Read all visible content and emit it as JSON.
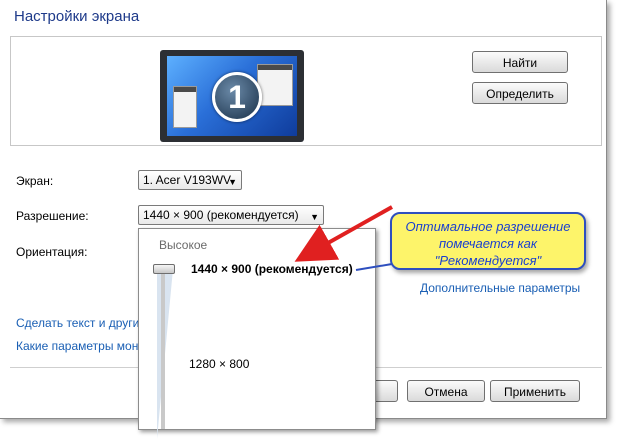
{
  "window": {
    "title": "Настройки экрана"
  },
  "buttons": {
    "find": "Найти",
    "identify": "Определить",
    "cancel": "Отмена",
    "apply": "Применить"
  },
  "monitor": {
    "number": "1"
  },
  "form": {
    "display_label": "Экран:",
    "display_value": "1. Acer V193WV",
    "resolution_label": "Разрешение:",
    "resolution_value": "1440 × 900 (рекомендуется)",
    "orientation_label": "Ориентация:"
  },
  "links": {
    "advanced": "Дополнительные параметры",
    "text_size": "Сделать текст и другие",
    "which_settings": "Какие параметры мон"
  },
  "resolution_popup": {
    "high_label": "Высокое",
    "top_option": "1440 × 900 (рекомендуется)",
    "lower_option": "1280 × 800",
    "slider_level": "1440 × 900"
  },
  "callout": {
    "lines": [
      "Оптимальное разрешение",
      "помечается как",
      "\"Рекомендуется\""
    ]
  },
  "colors": {
    "accent_link": "#1a5fb4",
    "callout_fill": "#fdf46a",
    "callout_border": "#2e4fbf",
    "arrow": "#e02020"
  }
}
